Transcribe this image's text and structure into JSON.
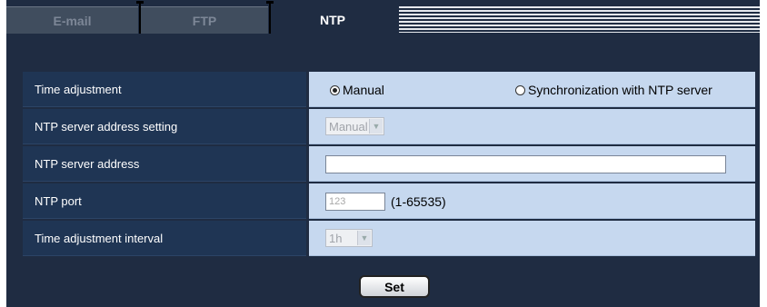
{
  "tabs": [
    {
      "label": "E-mail",
      "active": false
    },
    {
      "label": "FTP",
      "active": false
    },
    {
      "label": "NTP",
      "active": true
    }
  ],
  "settings": {
    "time_adjustment": {
      "label": "Time adjustment",
      "options": [
        "Manual",
        "Synchronization with NTP server"
      ],
      "selected": "Manual"
    },
    "ntp_server_address_setting": {
      "label": "NTP server address setting",
      "value": "Manual",
      "disabled": true
    },
    "ntp_server_address": {
      "label": "NTP server address",
      "value": ""
    },
    "ntp_port": {
      "label": "NTP port",
      "value": "123",
      "hint": "(1-65535)"
    },
    "time_adjustment_interval": {
      "label": "Time adjustment interval",
      "value": "1h",
      "disabled": true
    }
  },
  "set_button": {
    "label": "Set"
  },
  "icons": {
    "dropdown": "chevron-down-icon",
    "radio": "radio-icon"
  },
  "colors": {
    "frame_bg": "#1f2c42",
    "label_bg": "#1f3554",
    "value_bg": "#c6d8ef"
  }
}
